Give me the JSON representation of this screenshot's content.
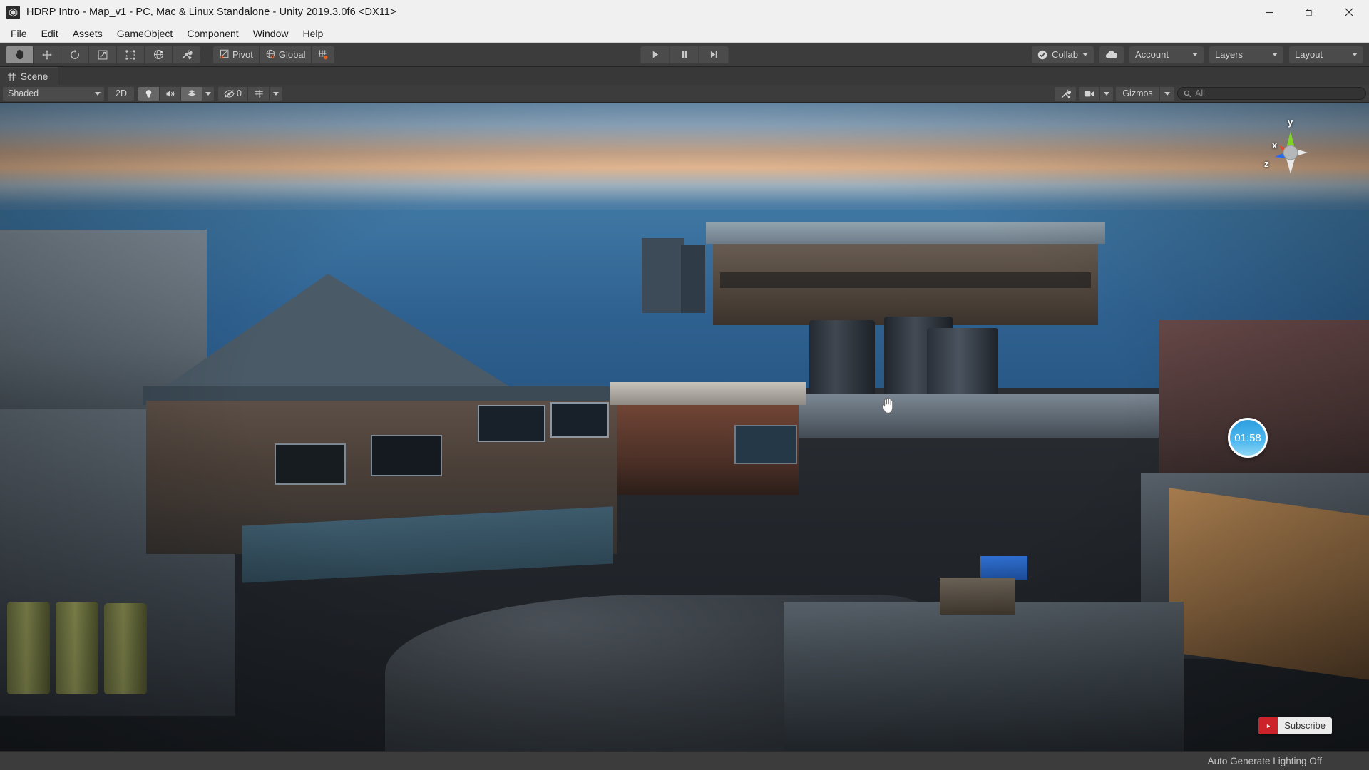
{
  "window": {
    "title": "HDRP Intro - Map_v1 - PC, Mac & Linux Standalone - Unity 2019.3.0f6 <DX11>",
    "app_icon": "unity-icon",
    "controls": {
      "minimize": "minimize-icon",
      "restore": "restore-icon",
      "close": "close-icon"
    }
  },
  "menubar": {
    "items": [
      {
        "label": "File"
      },
      {
        "label": "Edit"
      },
      {
        "label": "Assets"
      },
      {
        "label": "GameObject"
      },
      {
        "label": "Component"
      },
      {
        "label": "Window"
      },
      {
        "label": "Help"
      }
    ]
  },
  "toolbar": {
    "tools": [
      {
        "name": "hand-tool",
        "icon": "hand-icon",
        "active": true
      },
      {
        "name": "move-tool",
        "icon": "move-icon",
        "active": false
      },
      {
        "name": "rotate-tool",
        "icon": "rotate-icon",
        "active": false
      },
      {
        "name": "scale-tool",
        "icon": "scale-icon",
        "active": false
      },
      {
        "name": "rect-tool",
        "icon": "rect-transform-icon",
        "active": false
      },
      {
        "name": "transform-tool",
        "icon": "transform-icon",
        "active": false
      },
      {
        "name": "custom-tool",
        "icon": "wrench-screwdriver-icon",
        "active": false
      }
    ],
    "pivot_label": "Pivot",
    "handle_label": "Global",
    "snap_icon": "grid-snap-icon",
    "playback": {
      "play": "play-icon",
      "pause": "pause-icon",
      "step": "step-icon"
    },
    "collab_label": "Collab",
    "cloud_icon": "cloud-icon",
    "account_label": "Account",
    "layers_label": "Layers",
    "layout_label": "Layout"
  },
  "scene_tab": {
    "label": "Scene",
    "icon": "scene-grid-icon"
  },
  "scene_toolbar": {
    "draw_mode": "Shaded",
    "mode_2d": "2D",
    "lighting_icon": "light-bulb-icon",
    "audio_icon": "speaker-icon",
    "fx_icon": "effects-icon",
    "hidden_icon": "eye-slash-icon",
    "hidden_count": "0",
    "grid_icon": "grid-visibility-icon",
    "tools_icon": "scene-tools-icon",
    "camera_icon": "camera-icon",
    "gizmos_label": "Gizmos",
    "search_placeholder": "All",
    "search_value": "",
    "search_icon": "search-icon"
  },
  "viewport": {
    "gizmo": {
      "axis_x": "x",
      "axis_y": "y",
      "axis_z": "z",
      "color_x": "#e8482a",
      "color_y": "#7fd424",
      "color_z": "#2a6ae8"
    },
    "timer_badge": "01:58",
    "cursor": "hand-cursor",
    "subscribe": {
      "label": "Subscribe",
      "icon": "youtube-icon",
      "brand_color": "#cc2229"
    }
  },
  "statusbar": {
    "message": "Auto Generate Lighting Off"
  }
}
